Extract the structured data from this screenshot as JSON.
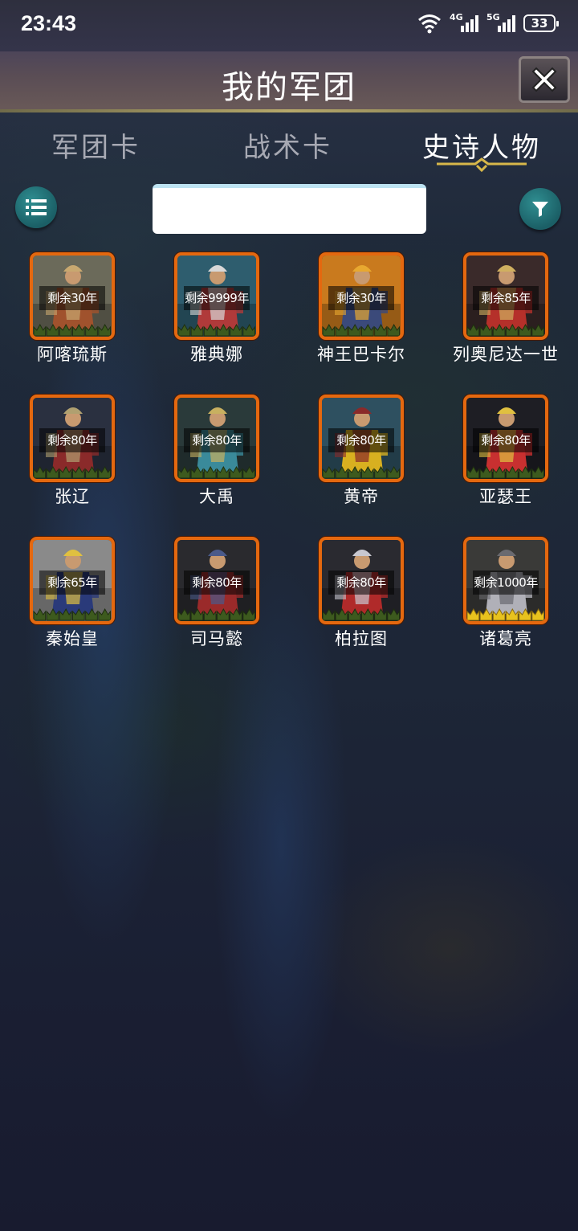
{
  "status_bar": {
    "time": "23:43",
    "network_1": "4G",
    "network_2": "5G",
    "battery": "33"
  },
  "header": {
    "title": "我的军团",
    "close_icon": "close-x-icon"
  },
  "tabs": [
    {
      "label": "军团卡",
      "active": false
    },
    {
      "label": "战术卡",
      "active": false
    },
    {
      "label": "史诗人物",
      "active": true
    }
  ],
  "toolbar": {
    "list_icon": "list-icon",
    "filter_icon": "filter-funnel-icon",
    "search_value": "",
    "search_placeholder": ""
  },
  "colors": {
    "card_border": "#e4680f",
    "teal_button": "#1b5f66",
    "crown_gold": "#e8c21e",
    "crown_green": "#3d5a1e"
  },
  "heroes": [
    {
      "name": "阿喀琉斯",
      "remaining": "剩余30年",
      "crown": "green",
      "palette": [
        "#6b6a5a",
        "#a0522d",
        "#c8a870"
      ]
    },
    {
      "name": "雅典娜",
      "remaining": "剩余9999年",
      "crown": "green",
      "palette": [
        "#2e5d6e",
        "#b03a3a",
        "#d8d8d8"
      ]
    },
    {
      "name": "神王巴卡尔",
      "remaining": "剩余30年",
      "crown": "green",
      "palette": [
        "#c97a1e",
        "#3b4a7a",
        "#e8a830"
      ]
    },
    {
      "name": "列奥尼达一世",
      "remaining": "剩余85年",
      "crown": "green",
      "palette": [
        "#3a2a2a",
        "#b5302a",
        "#d0b060"
      ]
    },
    {
      "name": "张辽",
      "remaining": "剩余80年",
      "crown": "green",
      "palette": [
        "#2a3040",
        "#8a2a2a",
        "#b0a070"
      ]
    },
    {
      "name": "大禹",
      "remaining": "剩余80年",
      "crown": "green",
      "palette": [
        "#2a3a3a",
        "#3a8a9a",
        "#c8b060"
      ]
    },
    {
      "name": "黄帝",
      "remaining": "剩余80年",
      "crown": "green",
      "palette": [
        "#2e5060",
        "#d8b020",
        "#8a2a2a"
      ]
    },
    {
      "name": "亚瑟王",
      "remaining": "剩余80年",
      "crown": "green",
      "palette": [
        "#1e1e24",
        "#c83030",
        "#e0c040"
      ]
    },
    {
      "name": "秦始皇",
      "remaining": "剩余65年",
      "crown": "green",
      "palette": [
        "#8a8a8a",
        "#2a3a7a",
        "#e0c040"
      ]
    },
    {
      "name": "司马懿",
      "remaining": "剩余80年",
      "crown": "green",
      "palette": [
        "#2a2a2e",
        "#9a2a2a",
        "#4a5a8a"
      ]
    },
    {
      "name": "柏拉图",
      "remaining": "剩余80年",
      "crown": "green",
      "palette": [
        "#2a2a30",
        "#b02a2a",
        "#c8c8d0"
      ]
    },
    {
      "name": "诸葛亮",
      "remaining": "剩余1000年",
      "crown": "gold",
      "palette": [
        "#3a3a38",
        "#b0b0b8",
        "#6a6a70"
      ]
    }
  ]
}
